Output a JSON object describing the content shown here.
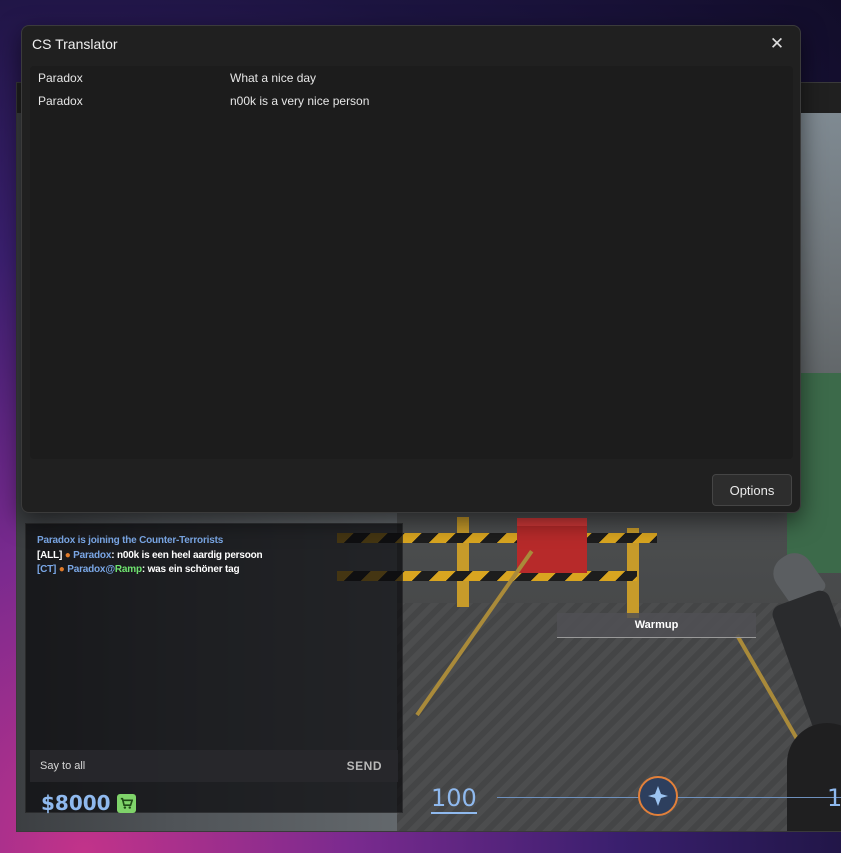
{
  "translator": {
    "title": "CS Translator",
    "close_glyph": "✕",
    "messages": [
      {
        "name": "Paradox",
        "text": "What a nice day"
      },
      {
        "name": "Paradox",
        "text": "n00k is a very nice person"
      }
    ],
    "options_label": "Options"
  },
  "game": {
    "warmup_label": "Warmup",
    "chat": {
      "lines": [
        {
          "parts": [
            "Paradox is joining the Counter-Terrorists"
          ]
        },
        {
          "prefix": "[ALL]",
          "dot": "●",
          "name": "Paradox",
          "sep": ":",
          "text": " n00k is een heel aardig persoon"
        },
        {
          "prefix": "[CT]",
          "dot": "●",
          "name": "Paradox",
          "at": "@",
          "location": "Ramp",
          "sep": ":",
          "text": " was ein schöner tag"
        }
      ],
      "input_placeholder": "Say to all",
      "send_label": "SEND"
    },
    "hud": {
      "money": "$8000",
      "buy_icon": "shopping-cart-icon",
      "health": "100",
      "armor": "1",
      "team_emblem_icon": "counter-terrorist-emblem-icon"
    }
  },
  "colors": {
    "ct_blue": "#7aa7e6",
    "accent_orange": "#e07b2a",
    "location_green": "#6fe36f",
    "hud_blue": "#8fb9ee"
  }
}
